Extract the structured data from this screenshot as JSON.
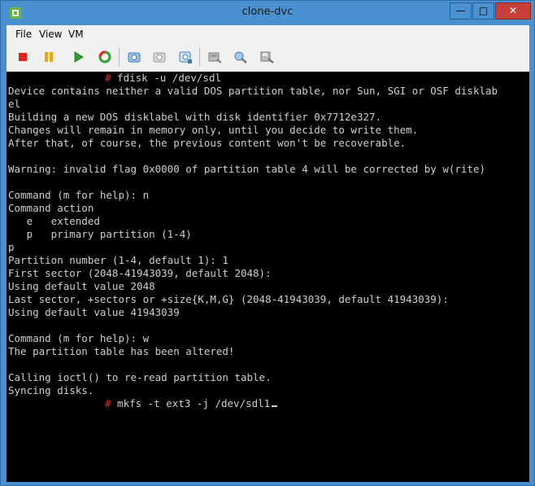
{
  "window": {
    "title": "clone-dvc"
  },
  "menubar": {
    "file": "File",
    "view": "View",
    "vm": "VM"
  },
  "toolbar": {
    "buttons": [
      {
        "name": "power-off-button",
        "icon": "stop-square-icon"
      },
      {
        "name": "suspend-button",
        "icon": "pause-icon"
      },
      {
        "name": "power-on-button",
        "icon": "play-icon"
      },
      {
        "name": "reset-button",
        "icon": "refresh-icon"
      },
      {
        "name": "snapshot-take-button",
        "icon": "snapshot-icon"
      },
      {
        "name": "snapshot-revert-button",
        "icon": "snapshot-revert-icon"
      },
      {
        "name": "snapshot-manager-button",
        "icon": "snapshot-manager-icon"
      },
      {
        "name": "cd-connect-button",
        "icon": "disk-icon"
      },
      {
        "name": "device-connect-button",
        "icon": "plug-icon"
      },
      {
        "name": "floppy-connect-button",
        "icon": "floppy-icon"
      }
    ]
  },
  "console": {
    "lines": [
      {
        "text": "# fdisk -u /dev/sdl",
        "prompt": true
      },
      {
        "text": "Device contains neither a valid DOS partition table, nor Sun, SGI or OSF disklab"
      },
      {
        "text": "el"
      },
      {
        "text": "Building a new DOS disklabel with disk identifier 0x7712e327."
      },
      {
        "text": "Changes will remain in memory only, until you decide to write them."
      },
      {
        "text": "After that, of course, the previous content won't be recoverable."
      },
      {
        "text": ""
      },
      {
        "text": "Warning: invalid flag 0x0000 of partition table 4 will be corrected by w(rite)"
      },
      {
        "text": ""
      },
      {
        "text": "Command (m for help): n"
      },
      {
        "text": "Command action"
      },
      {
        "text": "   e   extended"
      },
      {
        "text": "   p   primary partition (1-4)"
      },
      {
        "text": "p"
      },
      {
        "text": "Partition number (1-4, default 1): 1"
      },
      {
        "text": "First sector (2048-41943039, default 2048):"
      },
      {
        "text": "Using default value 2048"
      },
      {
        "text": "Last sector, +sectors or +size{K,M,G} (2048-41943039, default 41943039):"
      },
      {
        "text": "Using default value 41943039"
      },
      {
        "text": ""
      },
      {
        "text": "Command (m for help): w"
      },
      {
        "text": "The partition table has been altered!"
      },
      {
        "text": ""
      },
      {
        "text": "Calling ioctl() to re-read partition table."
      },
      {
        "text": "Syncing disks."
      },
      {
        "text": "# mkfs -t ext3 -j /dev/sdl1",
        "prompt": true,
        "cursor": true
      }
    ]
  }
}
